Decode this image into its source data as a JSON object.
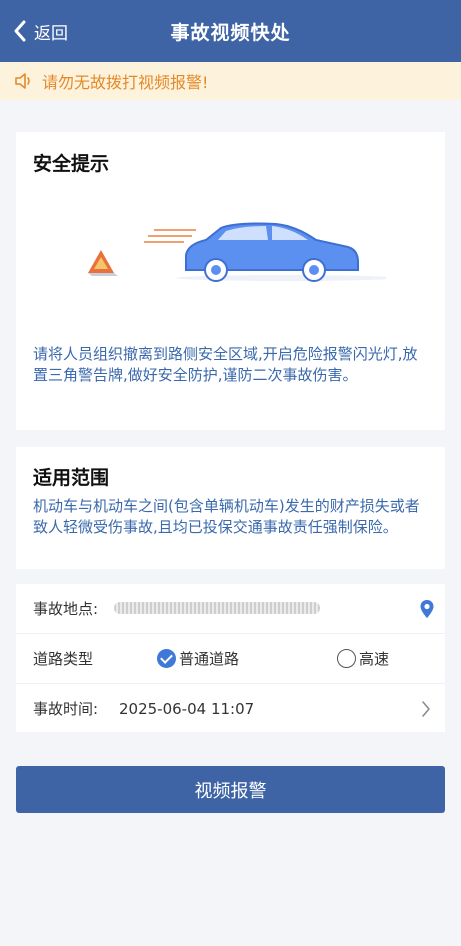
{
  "header": {
    "back_label": "返回",
    "title": "事故视频快处"
  },
  "notice": {
    "text": "请勿无故拨打视频报警!"
  },
  "safety": {
    "title": "安全提示",
    "text": "请将人员组织撤离到路侧安全区域,开启危险报警闪光灯,放置三角警告牌,做好安全防护,谨防二次事故伤害。"
  },
  "scope": {
    "title": "适用范围",
    "text": "机动车与机动车之间(包含单辆机动车)发生的财产损失或者致人轻微受伤事故,且均已投保交通事故责任强制保险。"
  },
  "form": {
    "location_label": "事故地点:",
    "road_type_label": "道路类型",
    "road_options": [
      "普通道路",
      "高速"
    ],
    "road_selected": "普通道路",
    "time_label": "事故时间:",
    "time_value": "2025-06-04 11:07"
  },
  "submit_label": "视频报警",
  "colors": {
    "primary": "#3f64a6",
    "notice_bg": "#fdf2dc",
    "notice_text": "#e48a2a",
    "accent_text": "#3a69ad"
  }
}
